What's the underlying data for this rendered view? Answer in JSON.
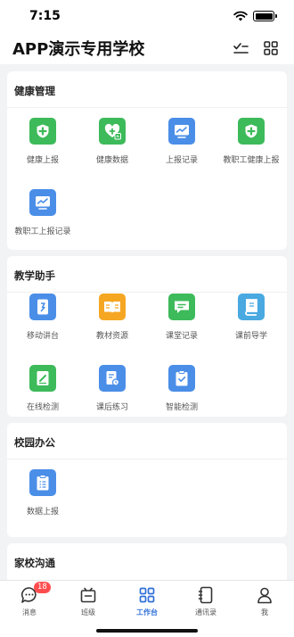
{
  "status_bar": {
    "time": "7:15"
  },
  "header": {
    "title": "APP演示专用学校"
  },
  "sections": [
    {
      "title": "健康管理",
      "items": [
        {
          "label": "健康上报",
          "icon": "health-plus-icon",
          "color": "#3dba5a"
        },
        {
          "label": "健康数据",
          "icon": "health-data-heart-icon",
          "color": "#3dba5a"
        },
        {
          "label": "上报记录",
          "icon": "report-record-chart-icon",
          "color": "#4a8ee8"
        },
        {
          "label": "教职工健康上报",
          "icon": "staff-health-plus-icon",
          "color": "#3dba5a"
        },
        {
          "label": "教职工上报记录",
          "icon": "staff-report-chart-icon",
          "color": "#4a8ee8"
        }
      ]
    },
    {
      "title": "教学助手",
      "items": [
        {
          "label": "移动讲台",
          "icon": "mobile-podium-icon",
          "color": "#4a8ee8"
        },
        {
          "label": "教材资源",
          "icon": "textbook-resources-icon",
          "color": "#f5a622"
        },
        {
          "label": "课堂记录",
          "icon": "classroom-record-chat-icon",
          "color": "#3dba5a"
        },
        {
          "label": "课前导学",
          "icon": "preclass-guide-book-icon",
          "color": "#49a9e0"
        },
        {
          "label": "在线检测",
          "icon": "online-test-edit-icon",
          "color": "#3dba5a"
        },
        {
          "label": "课后练习",
          "icon": "homework-practice-icon",
          "color": "#4a8ee8"
        },
        {
          "label": "智能检测",
          "icon": "smart-check-clipboard-icon",
          "color": "#4a8ee8"
        }
      ]
    },
    {
      "title": "校园办公",
      "items": [
        {
          "label": "数据上报",
          "icon": "data-report-form-icon",
          "color": "#4a8ee8"
        }
      ]
    },
    {
      "title": "家校沟通",
      "items": []
    }
  ],
  "tab_bar": {
    "tabs": [
      {
        "label": "消息",
        "icon": "message-icon",
        "badge": "18"
      },
      {
        "label": "班级",
        "icon": "class-icon"
      },
      {
        "label": "工作台",
        "icon": "workbench-icon",
        "active": true
      },
      {
        "label": "通讯录",
        "icon": "contacts-icon"
      },
      {
        "label": "我",
        "icon": "profile-icon"
      }
    ]
  }
}
